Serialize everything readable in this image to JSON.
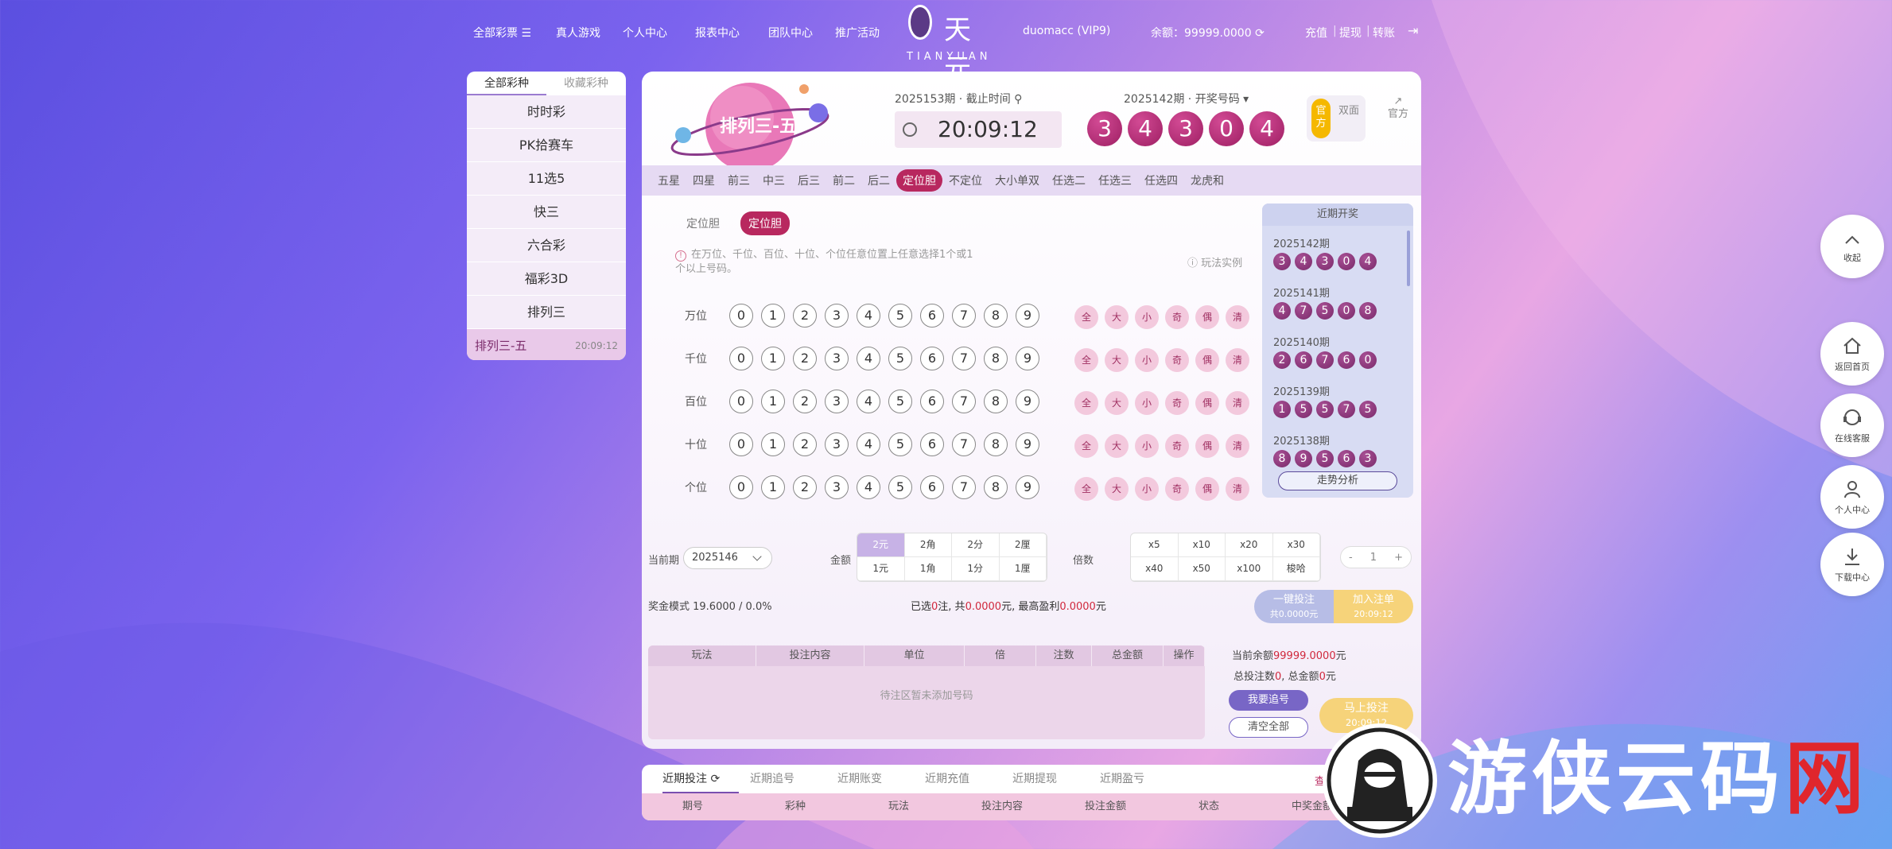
{
  "nav": {
    "all_lottery": "全部彩票",
    "live_games": "真人游戏",
    "personal_center": "个人中心",
    "reports": "报表中心",
    "team": "团队中心",
    "promo": "推广活动",
    "logo_name": "天元",
    "logo_sub": "TIANYUAN",
    "user": "duomacc (VIP9)",
    "balance_label": "余额：",
    "balance": "99999.0000",
    "recharge": "充值",
    "withdraw": "提现",
    "transfer": "转账",
    "sep": "|"
  },
  "left_menu": {
    "tabs": [
      "全部彩种",
      "收藏彩种"
    ],
    "items": [
      "时时彩",
      "PK拾赛车",
      "11选5",
      "快三",
      "六合彩",
      "福彩3D",
      "排列三"
    ],
    "active_item": "排列三-五",
    "active_time": "20:09:12"
  },
  "game": {
    "name": "排列三-五",
    "current_issue_label": "2025153期 · 截止时间",
    "countdown": "20:09:12",
    "draw_issue_label": "2025142期 · 开奖号码",
    "draw_numbers": [
      "3",
      "4",
      "3",
      "0",
      "4"
    ],
    "switch_on": "官方",
    "switch_off": "双面",
    "official": "官方"
  },
  "play_tabs": [
    "五星",
    "四星",
    "前三",
    "中三",
    "后三",
    "前二",
    "后二",
    "定位胆",
    "不定位",
    "大小单双",
    "任选二",
    "任选三",
    "任选四",
    "龙虎和"
  ],
  "active_play_tab": "定位胆",
  "sub_tabs": [
    "定位胆",
    "定位胆"
  ],
  "hint": "在万位、千位、百位、十位、个位任意位置上任意选择1个或1个以上号码。",
  "example": "玩法实例",
  "positions": [
    "万位",
    "千位",
    "百位",
    "十位",
    "个位"
  ],
  "digits": [
    "0",
    "1",
    "2",
    "3",
    "4",
    "5",
    "6",
    "7",
    "8",
    "9"
  ],
  "quick": [
    "全",
    "大",
    "小",
    "奇",
    "偶",
    "清"
  ],
  "recent": {
    "title": "近期开奖",
    "draws": [
      {
        "issue": "2025142期",
        "nums": [
          "3",
          "4",
          "3",
          "0",
          "4"
        ]
      },
      {
        "issue": "2025141期",
        "nums": [
          "4",
          "7",
          "5",
          "0",
          "8"
        ]
      },
      {
        "issue": "2025140期",
        "nums": [
          "2",
          "6",
          "7",
          "6",
          "0"
        ]
      },
      {
        "issue": "2025139期",
        "nums": [
          "1",
          "5",
          "5",
          "7",
          "5"
        ]
      },
      {
        "issue": "2025138期",
        "nums": [
          "8",
          "9",
          "5",
          "6",
          "3"
        ]
      }
    ],
    "trend": "走势分析"
  },
  "bet": {
    "current_issue_label": "当前期",
    "current_issue": "2025146",
    "amount_label": "金额",
    "amount_units": [
      "2元",
      "2角",
      "2分",
      "2厘",
      "1元",
      "1角",
      "1分",
      "1厘"
    ],
    "multiple_label": "倍数",
    "multiples": [
      "x5",
      "x10",
      "x20",
      "x30",
      "x40",
      "x50",
      "x100",
      "梭哈"
    ],
    "stepper_minus": "-",
    "stepper_value": "1",
    "stepper_plus": "+",
    "prize_mode": "奖金模式 19.6000 / 0.0%",
    "sum_prefix": "已选",
    "sum_count": "0",
    "sum_mid": "注, 共",
    "sum_total": "0.0000",
    "sum_mid2": "元, 最高盈利",
    "sum_profit": "0.0000",
    "sum_suffix": "元",
    "one_click": "一键投注",
    "one_click_sub": "共0.0000元",
    "add_to_slip": "加入注单",
    "add_to_slip_sub": "20:09:12",
    "table_headers": [
      "玩法",
      "投注内容",
      "单位",
      "倍",
      "注数",
      "总金额",
      "操作"
    ],
    "table_empty": "待注区暂未添加号码",
    "balance_prefix": "当前余额",
    "balance": "99999.0000",
    "balance_suffix": "元",
    "count_prefix": "总投注数",
    "count": "0",
    "count_mid": ", 总金额",
    "count_total": "0",
    "count_suffix": "元",
    "chase": "我要追号",
    "clear": "清空全部",
    "bet_now": "马上投注",
    "bet_now_sub": "20:09:12"
  },
  "bottom": {
    "tabs": [
      "近期投注",
      "近期追号",
      "近期账变",
      "近期充值",
      "近期提现",
      "近期盈亏"
    ],
    "view_all": "查看全部",
    "headers": [
      "期号",
      "彩种",
      "玩法",
      "投注内容",
      "投注金额",
      "状态",
      "中奖金额"
    ]
  },
  "float": [
    "收起",
    "返回首页",
    "在线客服",
    "个人中心",
    "下载中心"
  ],
  "watermark": {
    "text_main": "游侠云码",
    "text_red": "网"
  }
}
